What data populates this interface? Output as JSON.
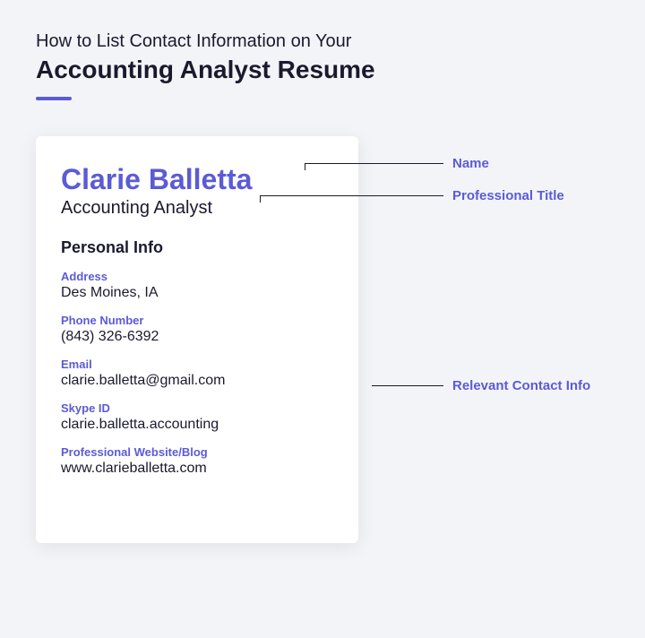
{
  "header": {
    "subtitle": "How to List Contact Information on Your",
    "title": "Accounting Analyst Resume"
  },
  "resume": {
    "name": "Clarie Balletta",
    "title": "Accounting Analyst",
    "section_heading": "Personal Info",
    "fields": {
      "address": {
        "label": "Address",
        "value": "Des Moines, IA"
      },
      "phone": {
        "label": "Phone Number",
        "value": "(843) 326-6392"
      },
      "email": {
        "label": "Email",
        "value": "clarie.balletta@gmail.com"
      },
      "skype": {
        "label": "Skype ID",
        "value": "clarie.balletta.accounting"
      },
      "website": {
        "label": "Professional Website/Blog",
        "value": "www.clarieballetta.com"
      }
    }
  },
  "annotations": {
    "name": "Name",
    "title": "Professional Title",
    "contact": "Relevant Contact Info"
  }
}
